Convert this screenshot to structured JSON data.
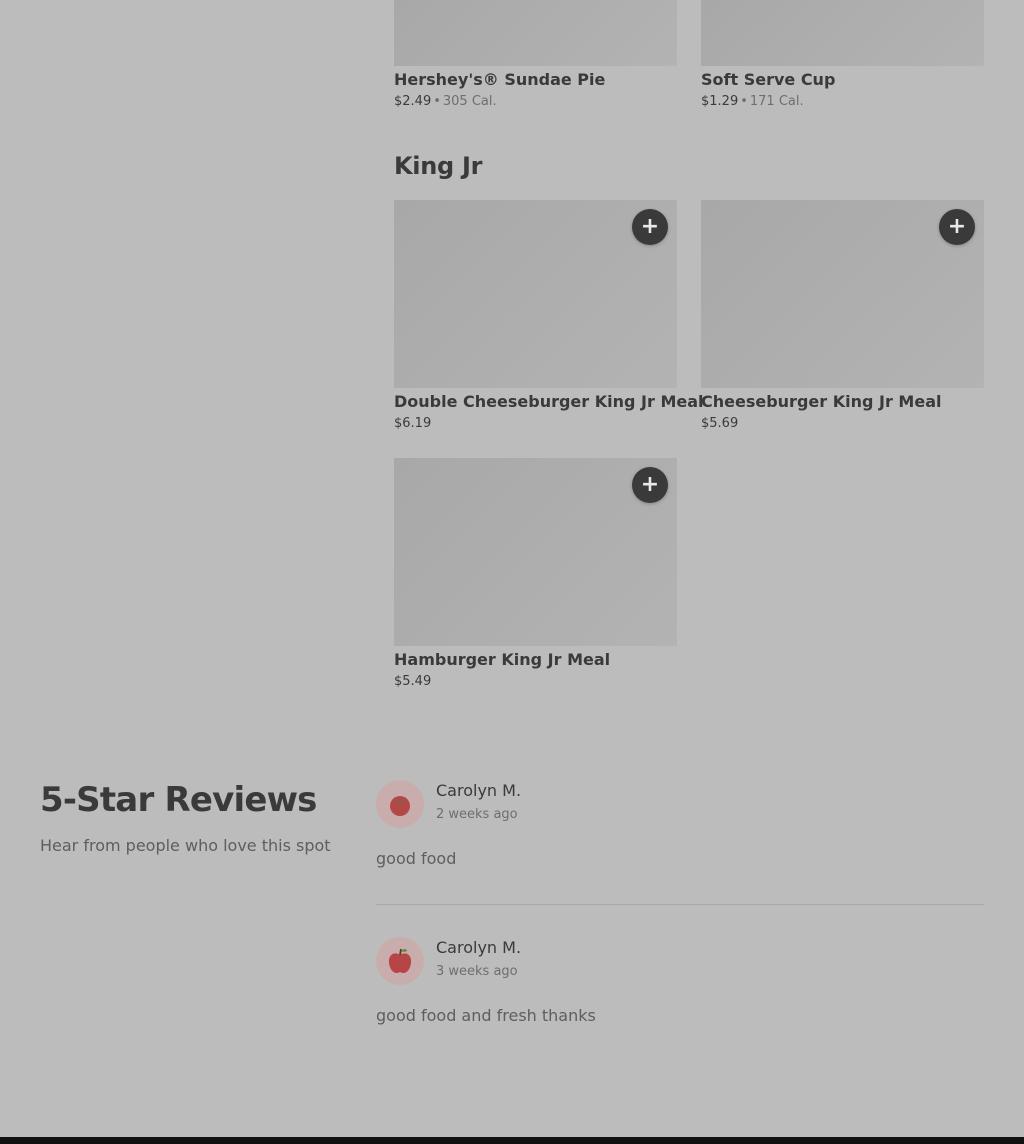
{
  "menu": {
    "top_items": [
      {
        "name": "Hershey's® Sundae Pie",
        "price": "$2.49",
        "calories": "305 Cal."
      },
      {
        "name": "Soft Serve Cup",
        "price": "$1.29",
        "calories": "171 Cal."
      }
    ],
    "section": {
      "title": "King Jr",
      "items": [
        {
          "name": "Double Cheeseburger King Jr Meal",
          "price": "$6.19"
        },
        {
          "name": "Cheeseburger King Jr Meal",
          "price": "$5.69"
        },
        {
          "name": "Hamburger King Jr Meal",
          "price": "$5.49"
        }
      ]
    },
    "separator": "•",
    "add_icon": "plus-icon",
    "add_symbol": "+"
  },
  "reviews": {
    "heading": "5-Star Reviews",
    "subtitle": "Hear from people who love this spot",
    "items": [
      {
        "author": "Carolyn M.",
        "date": "2 weeks ago",
        "text": "good food",
        "avatar_icon": "tomato-icon"
      },
      {
        "author": "Carolyn M.",
        "date": "3 weeks ago",
        "text": "good food and fresh thanks",
        "avatar_icon": "apple-icon"
      }
    ]
  },
  "colors": {
    "background": "#bcbcbc",
    "text": "#3a3a3a",
    "muted": "#6e6e6e",
    "button": "#3a3a3a",
    "footer": "#111111"
  }
}
